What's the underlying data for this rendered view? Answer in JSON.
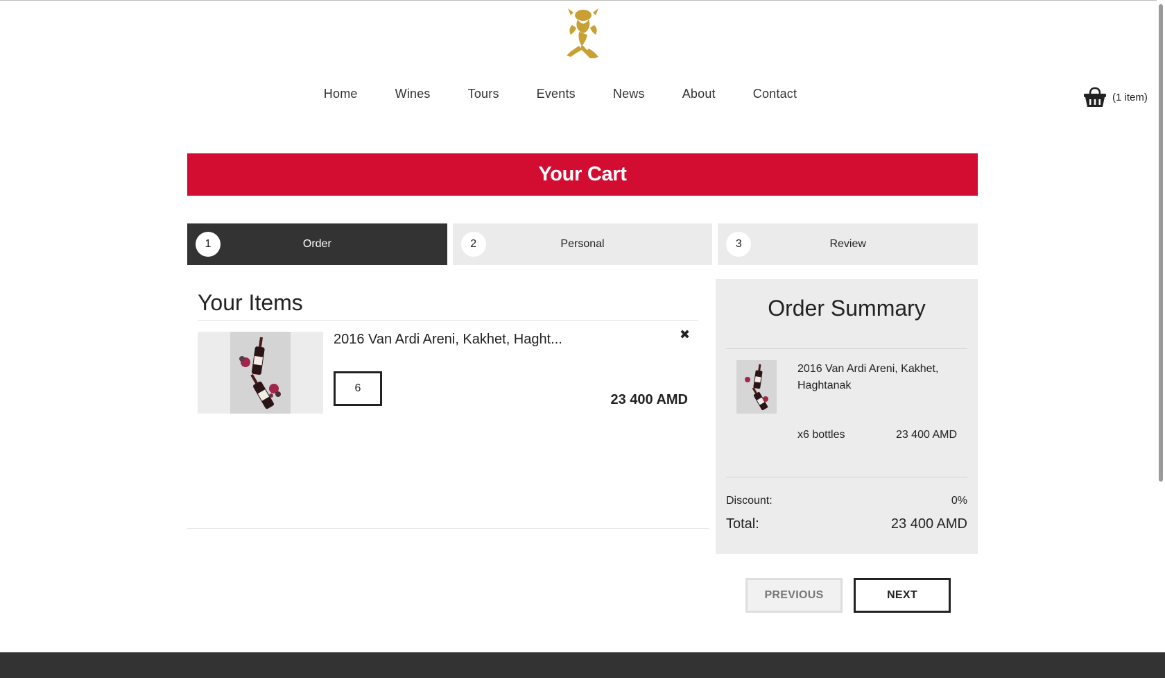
{
  "nav": {
    "items": [
      "Home",
      "Wines",
      "Tours",
      "Events",
      "News",
      "About",
      "Contact"
    ]
  },
  "cart_widget": {
    "icon": "basket-icon",
    "count_text": "(1 item)"
  },
  "banner": {
    "title": "Your Cart"
  },
  "steps": [
    {
      "number": "1",
      "label": "Order",
      "active": true
    },
    {
      "number": "2",
      "label": "Personal",
      "active": false
    },
    {
      "number": "3",
      "label": "Review",
      "active": false
    }
  ],
  "items": {
    "heading": "Your Items",
    "list": [
      {
        "name": "2016 Van Ardi Areni, Kakhet, Haght...",
        "quantity": "6",
        "price": "23 400 AMD",
        "remove_icon": "close-icon"
      }
    ]
  },
  "summary": {
    "heading": "Order Summary",
    "item_name": "2016 Van Ardi Areni, Kakhet, Haghtanak",
    "item_qty": "x6 bottles",
    "item_price": "23 400 AMD",
    "discount_label": "Discount:",
    "discount_value": "0%",
    "total_label": "Total:",
    "total_value": "23 400 AMD"
  },
  "buttons": {
    "previous": "PREVIOUS",
    "next": "NEXT"
  },
  "colors": {
    "accent": "#d30d32",
    "active_step": "#333333",
    "logo_gold": "#c9a033",
    "footer": "#333333"
  }
}
